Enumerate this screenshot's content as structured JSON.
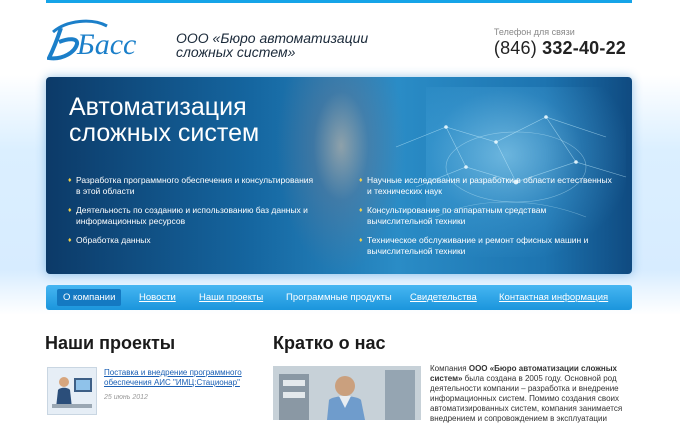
{
  "header": {
    "logo_text": "Басс",
    "company_name_line1": "ООО «Бюро автоматизации",
    "company_name_line2": "сложных систем»",
    "phone_label": "Телефон для связи",
    "phone_code": "(846)",
    "phone_number": "332-40-22"
  },
  "banner": {
    "title_line1": "Автоматизация",
    "title_line2": "сложных систем",
    "left_items": [
      "Разработка программного обеспечения и консультирования в этой области",
      "Деятельность по созданию и использованию  баз данных и информационных ресурсов",
      "Обработка данных"
    ],
    "right_items": [
      "Научные исследования и разработки в области естественных и технических наук",
      "Консультирование по аппаратным средствам вычислительной техники",
      "Техническое обслуживание и ремонт офисных машин и вычислительной техники"
    ]
  },
  "nav": {
    "items": [
      "О компании",
      "Новости",
      "Наши проекты",
      "Программные продукты",
      "Свидетельства",
      "Контактная информация"
    ]
  },
  "projects": {
    "heading": "Наши проекты",
    "items": [
      {
        "title": "Поставка и внедрение программного обеспечения АИС \"ИМЦ:Стационар\"",
        "date": "25 июнь 2012"
      }
    ]
  },
  "about": {
    "heading": "Кратко о нас",
    "text_prefix": "Компания ",
    "text_bold": "ООО «Бюро автоматизации сложных систем»",
    "text_rest": " была создана в 2005 году. Основной род деятельности компании – разработка и внедрение информационных систем. Помимо создания своих автоматизированных систем, компания занимается внедрением и сопровождением в эксплуатации"
  },
  "colors": {
    "accent": "#16a4e8",
    "nav_bg": "#2aa4e8",
    "link": "#1a5fb4",
    "bullet": "#f4d24a"
  }
}
